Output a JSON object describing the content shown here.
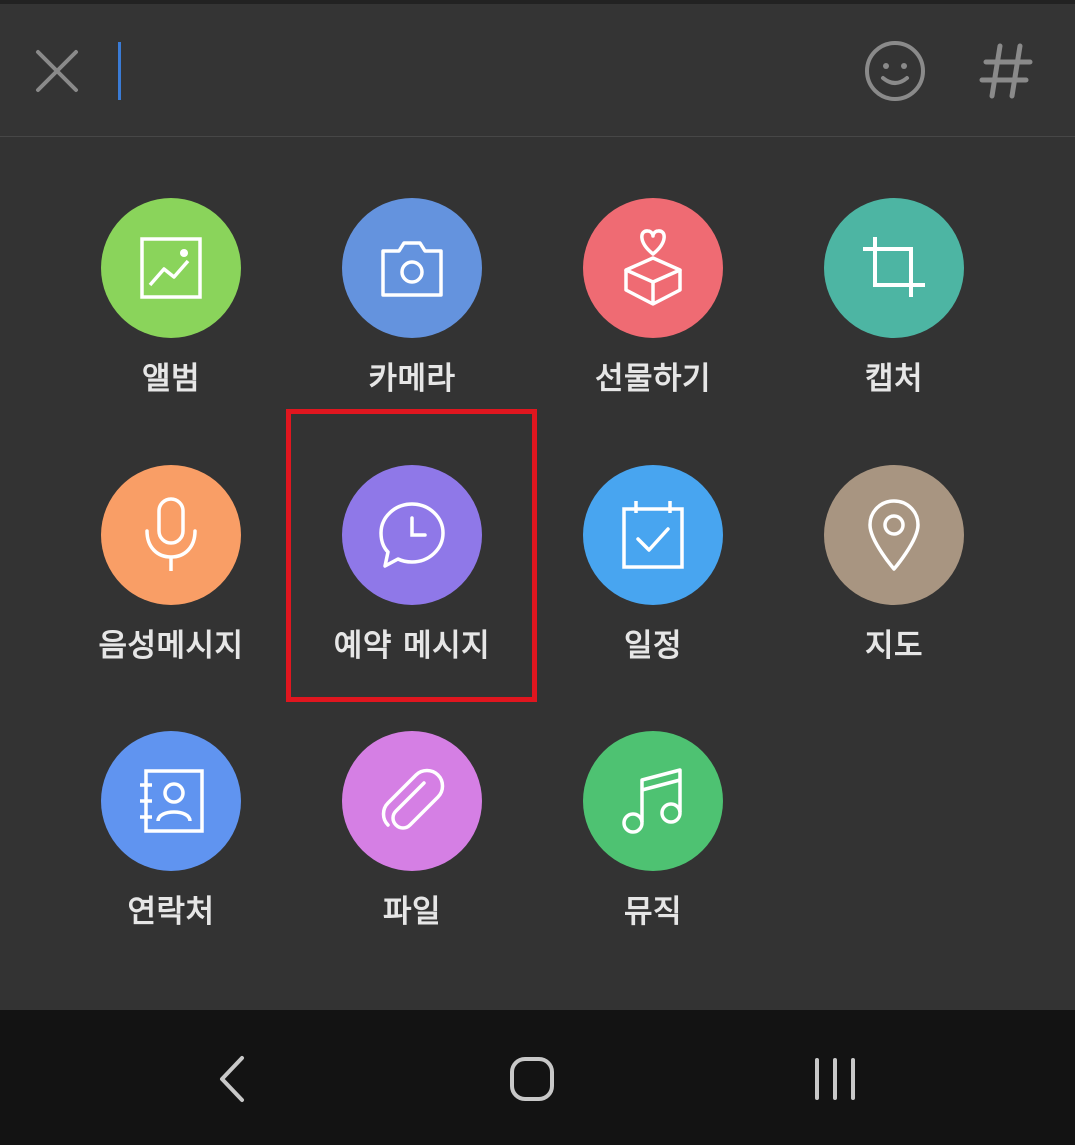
{
  "input": {
    "value": ""
  },
  "icons": {
    "close": "close-icon",
    "emoji": "emoji-icon",
    "hashtag": "hashtag-icon"
  },
  "attachments": [
    {
      "label": "앨범",
      "icon": "album-icon",
      "color": "#8ad45b"
    },
    {
      "label": "카메라",
      "icon": "camera-icon",
      "color": "#6493de"
    },
    {
      "label": "선물하기",
      "icon": "gift-icon",
      "color": "#ef6b73"
    },
    {
      "label": "캡처",
      "icon": "crop-icon",
      "color": "#4db5a3"
    },
    {
      "label": "음성메시지",
      "icon": "microphone-icon",
      "color": "#f99e66"
    },
    {
      "label": "예약 메시지",
      "icon": "scheduled-message-icon",
      "color": "#8f78e8",
      "highlighted": true
    },
    {
      "label": "일정",
      "icon": "calendar-icon",
      "color": "#48a5f0"
    },
    {
      "label": "지도",
      "icon": "map-pin-icon",
      "color": "#a89581"
    },
    {
      "label": "연락처",
      "icon": "contact-icon",
      "color": "#6094f0"
    },
    {
      "label": "파일",
      "icon": "paperclip-icon",
      "color": "#d57fe4"
    },
    {
      "label": "뮤직",
      "icon": "music-icon",
      "color": "#4ec272"
    }
  ],
  "highlight_color": "#e0161f",
  "navbar": {
    "back": "back-icon",
    "home": "home-icon",
    "recents": "recents-icon"
  }
}
